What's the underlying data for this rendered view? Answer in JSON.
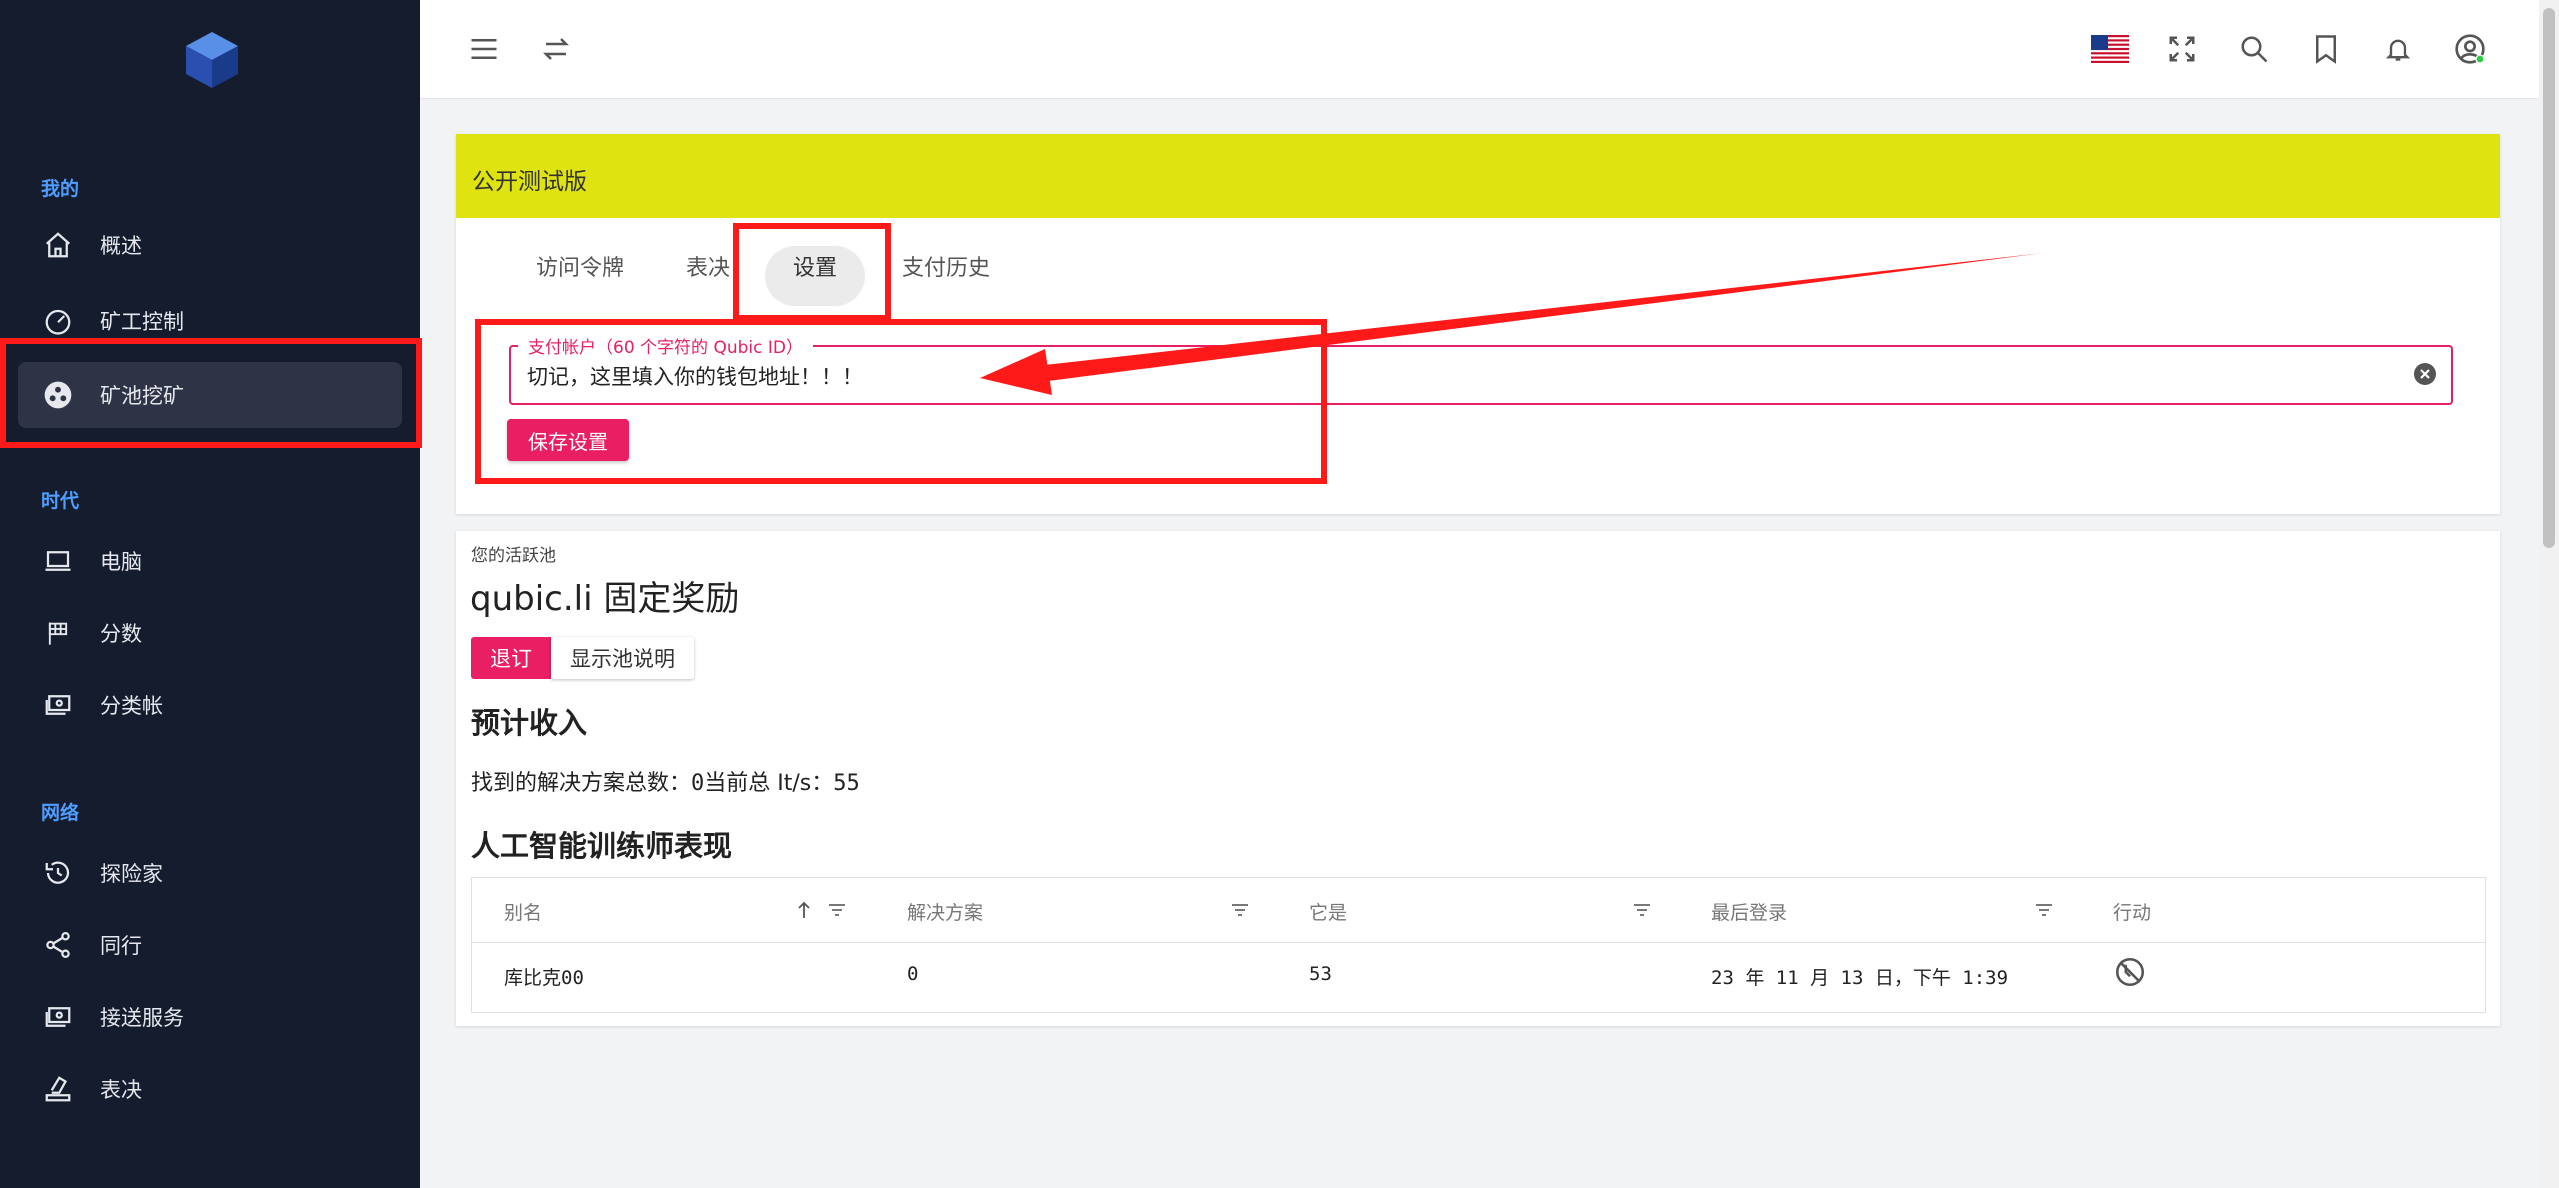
{
  "sidebar": {
    "sections": [
      {
        "title": "我的",
        "items": [
          {
            "label": "概述",
            "icon": "home-icon"
          },
          {
            "label": "矿工控制",
            "icon": "speedometer-icon"
          },
          {
            "label": "矿池挖矿",
            "icon": "pool-icon",
            "active": true
          }
        ]
      },
      {
        "title": "时代",
        "items": [
          {
            "label": "电脑",
            "icon": "laptop-icon"
          },
          {
            "label": "分数",
            "icon": "flag-icon"
          },
          {
            "label": "分类帐",
            "icon": "ledger-icon"
          }
        ]
      },
      {
        "title": "网络",
        "items": [
          {
            "label": "探险家",
            "icon": "history-icon"
          },
          {
            "label": "同行",
            "icon": "share-icon"
          },
          {
            "label": "接送服务",
            "icon": "money-icon"
          },
          {
            "label": "表决",
            "icon": "vote-icon"
          }
        ]
      }
    ]
  },
  "topbar": {
    "icons": [
      "menu-icon",
      "swap-icon",
      "us-flag-icon",
      "fullscreen-icon",
      "search-icon",
      "bookmark-icon",
      "bell-icon",
      "account-icon"
    ]
  },
  "settings_card": {
    "banner": "公开测试版",
    "tabs": [
      {
        "label": "访问令牌"
      },
      {
        "label": "表决"
      },
      {
        "label": "设置",
        "active": true
      },
      {
        "label": "支付历史"
      }
    ],
    "field_legend": "支付帐户（60 个字符的 Qubic ID）",
    "field_value": "切记，这里填入你的钱包地址！！！",
    "save_label": "保存设置"
  },
  "pool_card": {
    "subtitle": "您的活跃池",
    "title": "qubic.li 固定奖励",
    "unsubscribe_label": "退订",
    "show_desc_label": "显示池说明",
    "income_heading": "预计收入",
    "income_line": {
      "solutions_label": "找到的解决方案总数：",
      "solutions_value": "0",
      "its_label": "当前总 It/s：",
      "its_value": "55"
    },
    "ai_heading": "人工智能训练师表现",
    "table": {
      "headers": [
        "别名",
        "解决方案",
        "它是",
        "最后登录",
        "行动"
      ],
      "rows": [
        {
          "alias": "库比克00",
          "solutions": "0",
          "its": "53",
          "last_login": "23 年 11 月 13 日，下午 1:39"
        }
      ]
    }
  },
  "colors": {
    "sidebar_bg": "#141c2e",
    "section_title": "#4f9dff",
    "banner": "#dfe30f",
    "accent": "#e91e63",
    "annotation": "#ff1a1a"
  }
}
